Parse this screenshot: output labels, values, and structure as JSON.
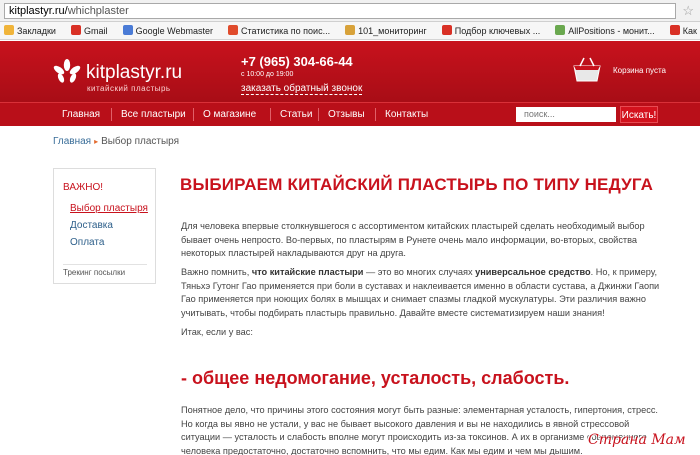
{
  "browser": {
    "url_domain": "kitplastyr.ru/",
    "url_path": "whichplaster",
    "bookmarks": [
      {
        "label": "Закладки",
        "color": "#f0b43a"
      },
      {
        "label": "Gmail",
        "color": "#d93025"
      },
      {
        "label": "Google Webmaster",
        "color": "#4a7bd6"
      },
      {
        "label": "Статистика по поис...",
        "color": "#e04b2c"
      },
      {
        "label": "101_мониторинг",
        "color": "#d8a23a"
      },
      {
        "label": "Подбор ключевых ...",
        "color": "#d93025"
      },
      {
        "label": "AllPositions - монит...",
        "color": "#6aa84f"
      },
      {
        "label": "Как получить нача...",
        "color": "#d93025"
      }
    ]
  },
  "header": {
    "logo_name": "kitplastyr.ru",
    "logo_tagline": "китайский пластырь",
    "phone": "+7 (965) 304-66-44",
    "hours": "с 10:00 до 19:00",
    "callback": "заказать обратный звонок",
    "cart_text": "Корзина пуста"
  },
  "nav": {
    "items": [
      "Главная",
      "Все пластыри",
      "О магазине",
      "Статьи",
      "Отзывы",
      "Контакты"
    ],
    "search_placeholder": "поиск...",
    "search_button": "Искать!"
  },
  "breadcrumb": {
    "home": "Главная",
    "current": "Выбор пластыря"
  },
  "sidebar": {
    "heading": "ВАЖНО!",
    "links": [
      "Выбор пластыря",
      "Доставка",
      "Оплата"
    ],
    "tracking": "Трекинг посылки"
  },
  "main": {
    "title": "ВЫБИРАЕМ КИТАЙСКИЙ ПЛАСТЫРЬ ПО ТИПУ НЕДУГА",
    "p1": "Для человека впервые столкнувшегося с ассортиментом китайских пластырей сделать необходимый выбор бывает очень непросто. Во-первых, по пластырям в Рунете очень мало информации, во-вторых, свойства некоторых пластырей накладываются друг на друга.",
    "p2_a": "Важно помнить, ",
    "p2_b": "что китайские пластыри",
    "p2_c": " — это во многих случаях ",
    "p2_d": "универсальное средство",
    "p2_e": ". Но, к примеру, Тяньхэ Гутонг Гао применяется при боли в суставах и наклеивается именно в области сустава, а Джинжи Гаопи Гао применяется при ноющих болях в мышцах и снимает спазмы гладкой мускулатуры. Эти различия важно учитывать, чтобы подбирать пластырь правильно. Давайте вместе систематизируем наши знания!",
    "p3": "Итак, если у вас:",
    "subhead": "- общее недомогание, усталость, слабость.",
    "p4": "Понятное дело, что причины этого состояния могут быть разные: элементарная усталость, гипертония, стресс. Но когда вы явно не устали, у вас не бывает высокого давления и вы не находились в явной стрессовой ситуации — усталость и слабость вполне могут происходить из-за токсинов. А их в организме современного человека предостаточно, достаточно вспомнить, что мы едим. Как мы едим и чем мы дышим."
  },
  "watermark": "Страна Мам"
}
